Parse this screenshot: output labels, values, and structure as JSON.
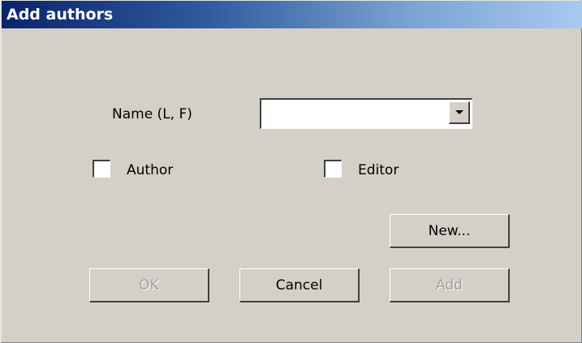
{
  "dialog": {
    "title": "Add authors"
  },
  "form": {
    "name_label": "Name (L, F)",
    "name_value": "",
    "author_label": "Author",
    "author_checked": false,
    "editor_label": "Editor",
    "editor_checked": false
  },
  "buttons": {
    "new_label": "New...",
    "ok_label": "OK",
    "ok_enabled": false,
    "cancel_label": "Cancel",
    "add_label": "Add",
    "add_enabled": false
  },
  "icons": {
    "dropdown": "chevron-down-icon"
  },
  "colors": {
    "dialog_bg": "#d4d0c8",
    "title_start": "#0a246a",
    "title_end": "#a6caf0",
    "disabled_text": "#a0a0a0"
  }
}
